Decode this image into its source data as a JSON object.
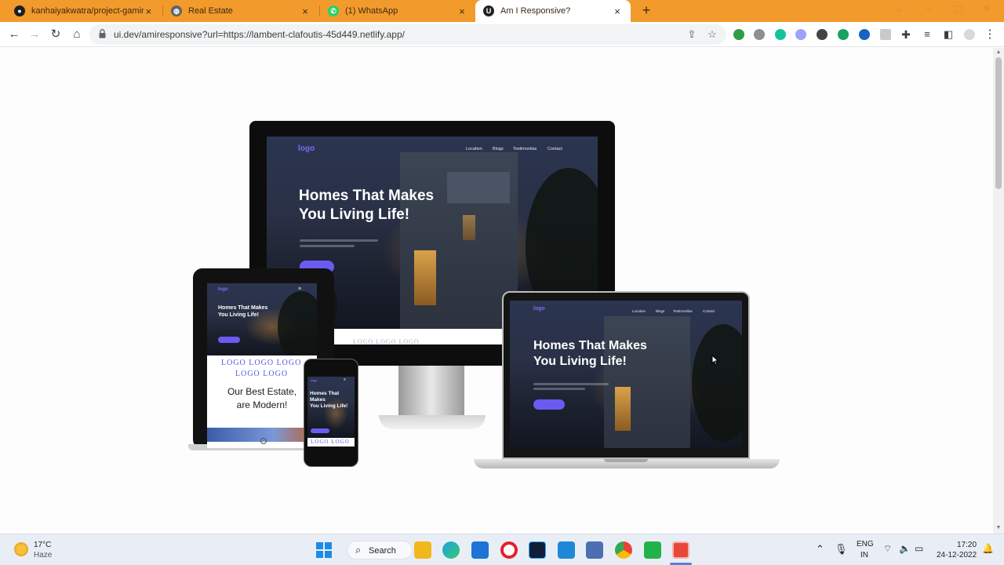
{
  "browser": {
    "tabs": [
      {
        "title": "kanhaiyakwatra/project-gaming",
        "icon": "github-icon"
      },
      {
        "title": "Real Estate",
        "icon": "globe-icon"
      },
      {
        "title": "(1) WhatsApp",
        "icon": "whatsapp-icon"
      },
      {
        "title": "Am I Responsive?",
        "icon": "amiresponsive-icon",
        "active": true
      }
    ],
    "url": "ui.dev/amiresponsive?url=https://lambent-clafoutis-45d449.netlify.app/",
    "accent": "#f39a2c"
  },
  "site": {
    "logo": "logo",
    "nav": [
      "Location",
      "Blogs",
      "Testimonilas",
      "Contact"
    ],
    "headline_line1": "Homes That Makes",
    "headline_line2": "You Living Life!",
    "tablet_headline_line1": "Homes That Makes",
    "tablet_headline_line2": "You Living Life!",
    "phone_headline_line1": "Homes That",
    "phone_headline_line2": "Makes",
    "phone_headline_line3": "You Living Life!",
    "partner_logos_row1": "LOGO  LOGO  LOGO",
    "partner_logos_row2": "LOGO  LOGO",
    "phone_logos": "LOGO  LOGO",
    "section_title_line1": "Our Best Estate,",
    "section_title_line2": "are Modern!",
    "brand_color": "#6a5cf0"
  },
  "taskbar": {
    "weather_temp": "17°C",
    "weather_desc": "Haze",
    "search_label": "Search",
    "lang_line1": "ENG",
    "lang_line2": "IN",
    "time": "17:20",
    "date": "24-12-2022"
  }
}
